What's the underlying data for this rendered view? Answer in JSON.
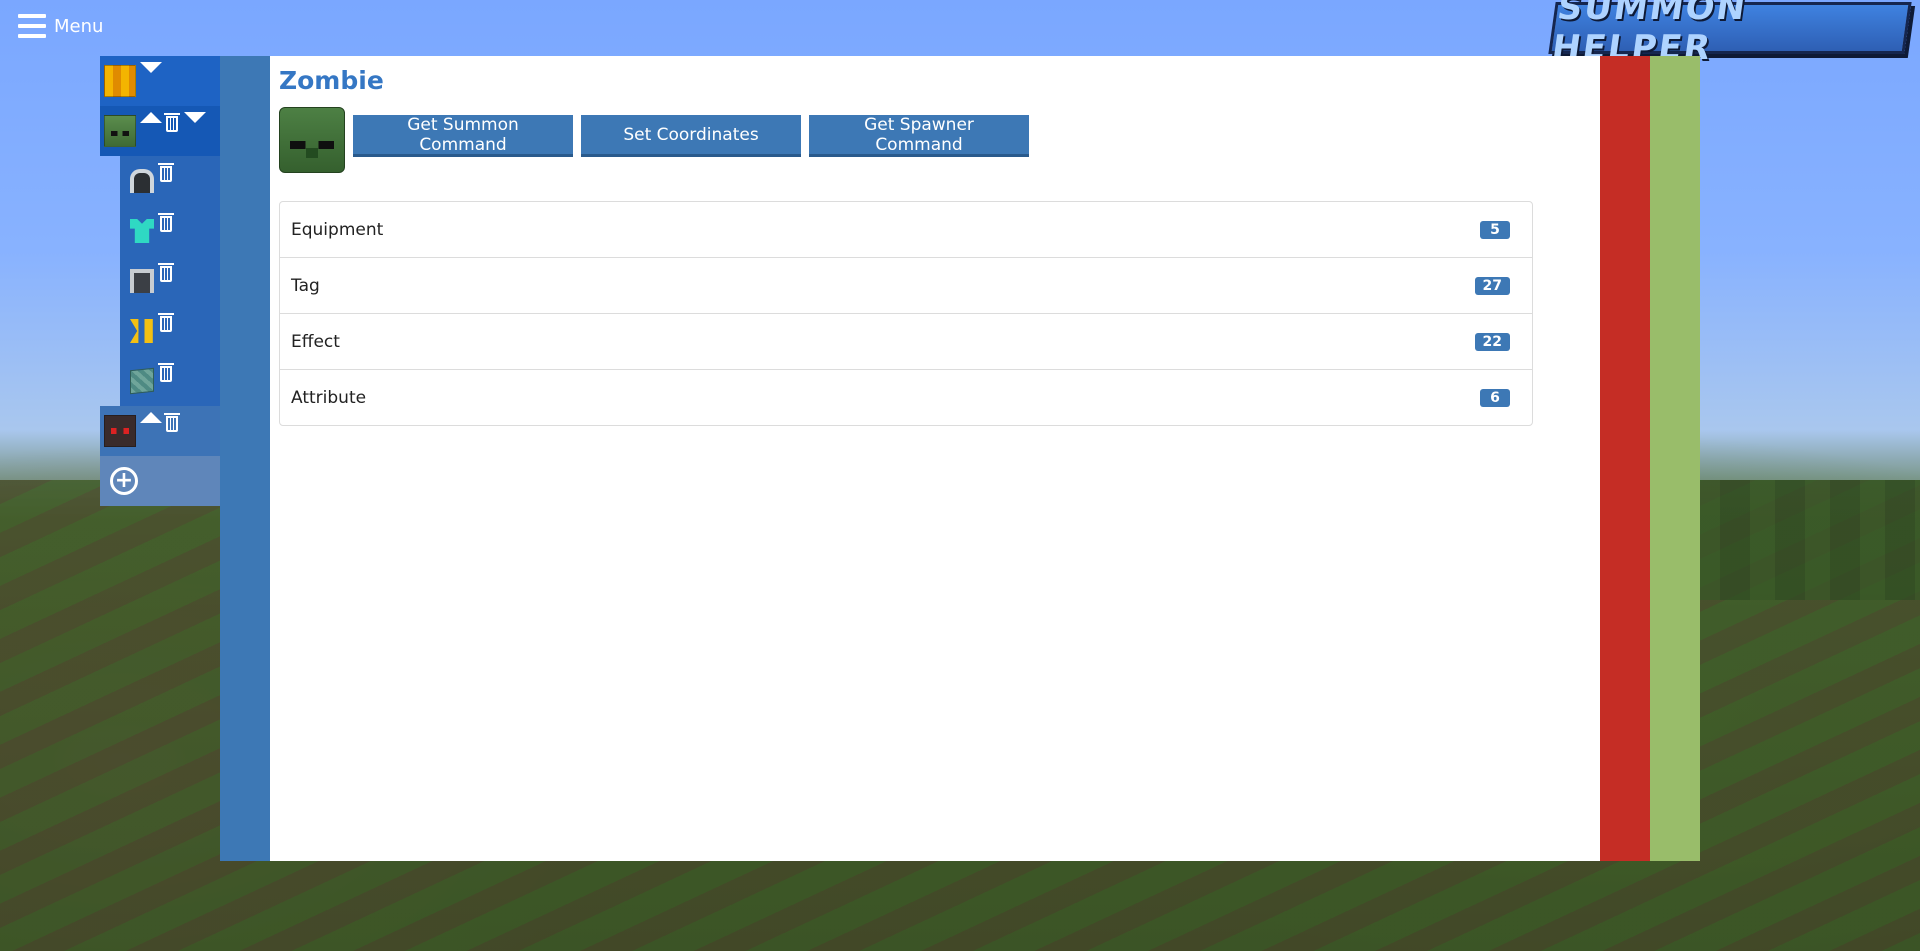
{
  "header": {
    "menu_label": "Menu",
    "logo_text": "SUMMON HELPER"
  },
  "tree": {
    "entities": [
      {
        "name": "Blaze",
        "icon": "blaze-head-icon"
      },
      {
        "name": "Zombie",
        "icon": "zombie-head-icon"
      },
      {
        "name": "Cave Spider",
        "icon": "spider-head-icon"
      }
    ],
    "zombie_items": [
      {
        "icon": "helmet-icon"
      },
      {
        "icon": "chestplate-icon"
      },
      {
        "icon": "leggings-icon"
      },
      {
        "icon": "boots-icon"
      },
      {
        "icon": "block-icon"
      }
    ],
    "add_icon": "plus-circle-icon"
  },
  "main": {
    "title": "Zombie",
    "buttons": {
      "summon": "Get Summon Command",
      "coordinates": "Set Coordinates",
      "spawner": "Get Spawner Command"
    },
    "sections": [
      {
        "label": "Equipment",
        "count": "5"
      },
      {
        "label": "Tag",
        "count": "27"
      },
      {
        "label": "Effect",
        "count": "22"
      },
      {
        "label": "Attribute",
        "count": "6"
      }
    ]
  },
  "colors": {
    "primary_blue": "#3d78b5",
    "title_blue": "#3577c4",
    "red_stripe": "#c52d25",
    "green_stripe": "#99bd6a"
  }
}
